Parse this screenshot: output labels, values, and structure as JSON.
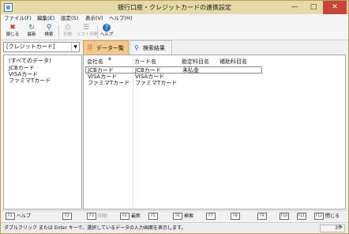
{
  "window": {
    "title": "銀行口座・クレジットカードの連携設定"
  },
  "menu": [
    "ファイル(F)",
    "編集(E)",
    "設定(S)",
    "表示(V)",
    "ヘルプ(H)"
  ],
  "toolbar": {
    "close": "閉じる",
    "refresh": "最新",
    "search": "検索",
    "print": "印刷",
    "list_print": "リスト印刷",
    "help": "ヘルプ"
  },
  "category": {
    "selected": "[クレジットカード]"
  },
  "tabs": {
    "list": "データ一覧",
    "results": "検索結果"
  },
  "tree": [
    "(すべてのデータ)",
    "JCBカード",
    "VISAカード",
    "ファミマTカード"
  ],
  "table": {
    "columns": [
      "会社名",
      "カード名",
      "勘定科目名",
      "補助科目名"
    ],
    "rows": [
      {
        "company": "JCBカード",
        "card": "JCBカード",
        "account": "未払金",
        "sub": ""
      },
      {
        "company": "VISAカード",
        "card": "VISAカード",
        "account": "",
        "sub": ""
      },
      {
        "company": "ファミマTカード",
        "card": "ファミマTカード",
        "account": "",
        "sub": ""
      }
    ]
  },
  "fkeys": {
    "f1": {
      "key": "F1",
      "label": "ヘルプ"
    },
    "f2": {
      "key": "F2",
      "label": ""
    },
    "f3": {
      "key": "F3",
      "label": "印刷"
    },
    "f4": {
      "key": "F4",
      "label": "最新"
    },
    "f5": {
      "key": "F5",
      "label": ""
    },
    "f6": {
      "key": "F6",
      "label": "検索"
    },
    "f7": {
      "key": "F7",
      "label": ""
    },
    "f8": {
      "key": "F8",
      "label": ""
    },
    "f9": {
      "key": "F9",
      "label": ""
    },
    "f10": {
      "key": "F10",
      "label": ""
    },
    "f11": {
      "key": "F11",
      "label": ""
    },
    "f12": {
      "key": "F12",
      "label": "閉じる"
    }
  },
  "status": {
    "message": "ダブルクリック または Enter キーで、選択しているデータの入力画面を表示します。",
    "count": "3件"
  },
  "colors": {
    "title_bar": "#e8d9a8",
    "active_tab": "#f6c78a",
    "close_button": "#c7463a"
  }
}
